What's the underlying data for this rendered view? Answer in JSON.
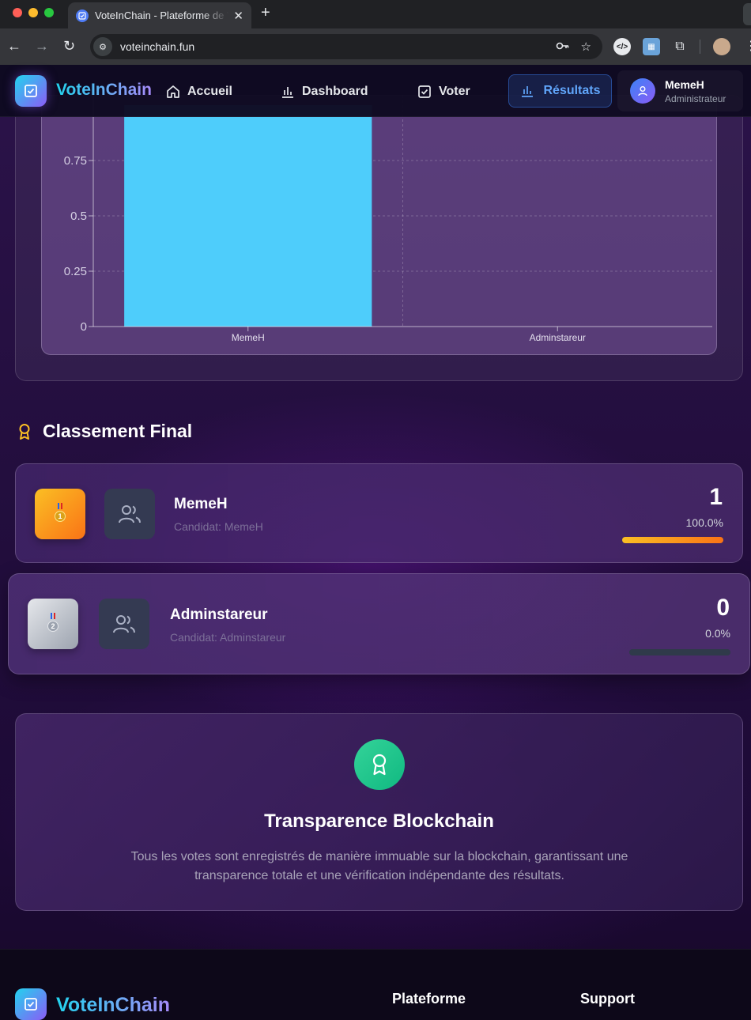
{
  "browser": {
    "tab_title": "VoteInChain - Plateforme de Vote",
    "url": "voteinchain.fun"
  },
  "header": {
    "brand": "VoteInChain",
    "nav": {
      "accueil": "Accueil",
      "dashboard": "Dashboard",
      "voter": "Voter",
      "resultats": "Résultats"
    },
    "user": {
      "name": "MemeH",
      "role": "Administrateur"
    }
  },
  "chart_data": {
    "type": "bar",
    "categories": [
      "MemeH",
      "Adminstareur"
    ],
    "values": [
      1,
      0
    ],
    "yticks": [
      "0",
      "0.25",
      "0.5",
      "0.75"
    ],
    "ylim": [
      0,
      1
    ],
    "bar_color": "#4ecdfb",
    "grid": true
  },
  "ranking": {
    "title": "Classement Final",
    "items": [
      {
        "rank": "1",
        "name": "MemeH",
        "subtitle": "Candidat: MemeH",
        "votes": "1",
        "percent": "100.0%",
        "fraction": 1.0
      },
      {
        "rank": "2",
        "name": "Adminstareur",
        "subtitle": "Candidat: Adminstareur",
        "votes": "0",
        "percent": "0.0%",
        "fraction": 0.0
      }
    ]
  },
  "transparency": {
    "title": "Transparence Blockchain",
    "text": "Tous les votes sont enregistrés de manière immuable sur la blockchain, garantissant une transparence totale et une vérification indépendante des résultats."
  },
  "footer": {
    "brand": "VoteInChain",
    "col1": "Plateforme",
    "col2": "Support"
  },
  "colors": {
    "accent": "#60a5fa",
    "gold": "#fbbf24",
    "bar": "#4ecdfb",
    "success": "#10b981"
  }
}
